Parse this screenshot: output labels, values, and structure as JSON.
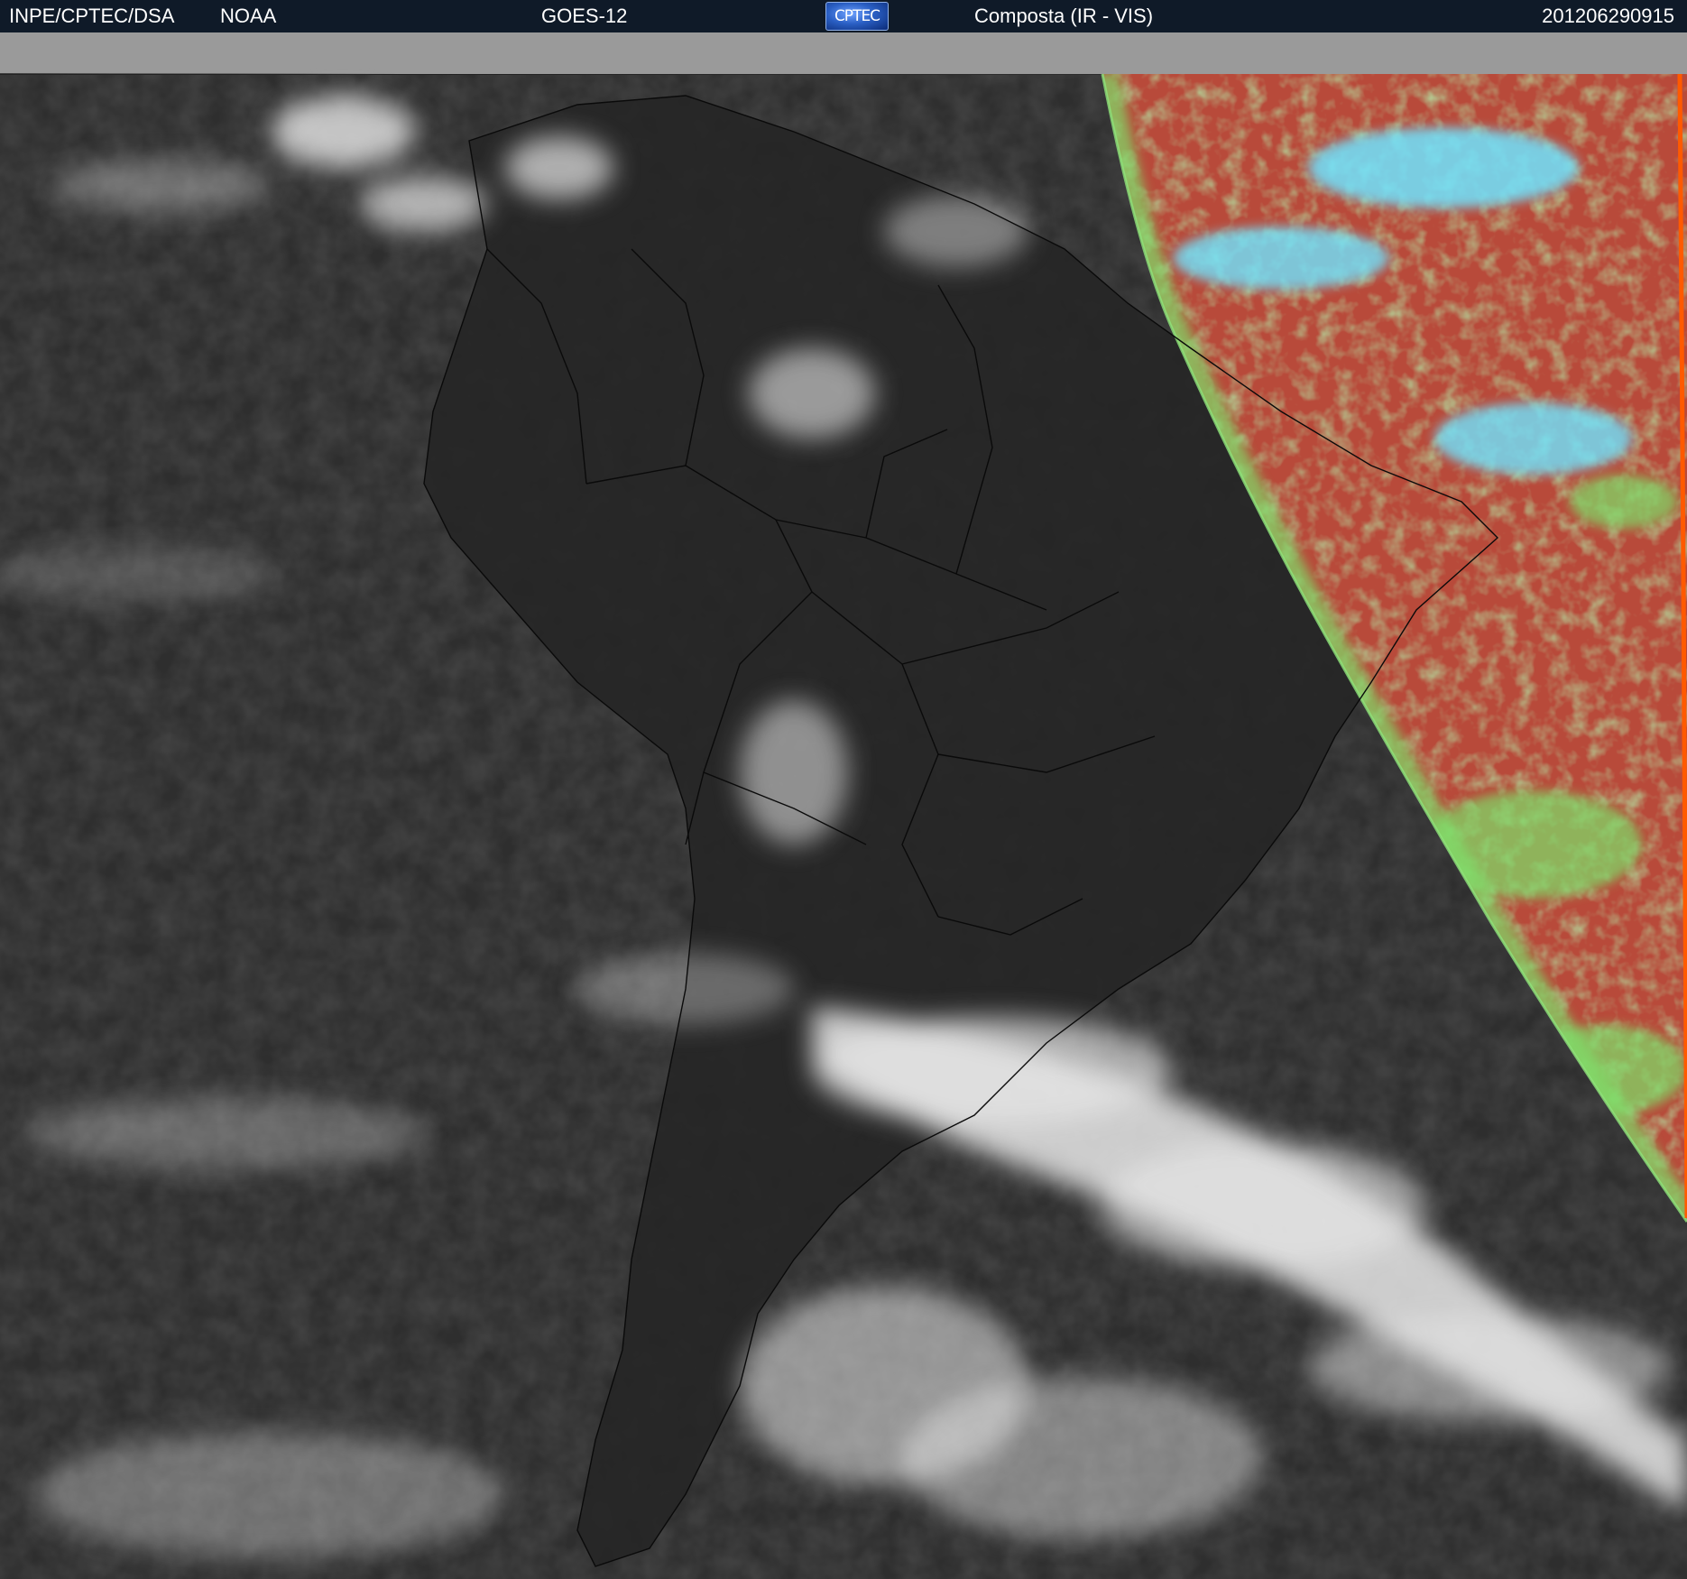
{
  "header": {
    "organization": "INPE/CPTEC/DSA",
    "agency": "NOAA",
    "satellite": "GOES-12",
    "logo_text": "CPTEC",
    "product": "Composta (IR - VIS)",
    "timestamp": "201206290915"
  },
  "colors": {
    "header_bg": "#0f1a28",
    "ir_background": "#2d2d2d",
    "vis_red": "#b84a3a",
    "vis_green": "#7ee06a",
    "vis_cyan": "#6fe4ff",
    "cloud_white": "#e8e8e8"
  }
}
